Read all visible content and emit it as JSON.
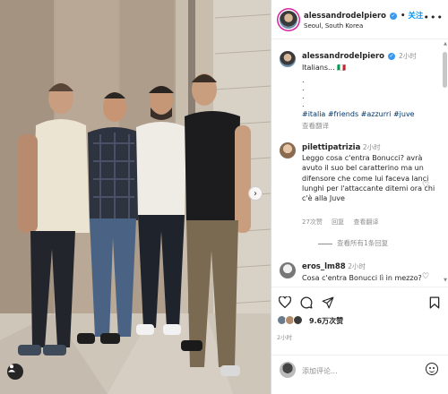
{
  "header": {
    "username": "alessandrodelpiero",
    "verified_mark": "✓",
    "separator": "•",
    "follow_label": "关注",
    "location": "Seoul, South Korea",
    "more_icon": "more-icon"
  },
  "caption": {
    "username": "alessandrodelpiero",
    "time": "2小时",
    "text": "Italians... 🇮🇹",
    "dots": ".\n.\n.\n.",
    "hashtags": "#italia #friends #azzurri #juve",
    "translate_label": "查看翻译"
  },
  "comments": [
    {
      "username": "pilettipatrizia",
      "time": "2小时",
      "text": "Leggo cosa c'entra Bonucci? avrà avuto il suo bel caratterino ma un difensore che come lui faceva lanci lunghi per l'attaccante ditemi ora chi c'è alla Juve",
      "likes": "27次赞",
      "reply_label": "回复",
      "translate_label": "查看翻译",
      "view_replies_label": "查看所有1条回复"
    },
    {
      "username": "eros_lm88",
      "time": "2小时",
      "text": "Cosa c'entra Bonucci lì in mezzo?"
    }
  ],
  "likes_summary": "9.6万次赞",
  "post_time": "2小时",
  "add_comment_placeholder": "添加评论...",
  "colors": {
    "accent": "#0095f6",
    "hashtag": "#00376b",
    "secondary_text": "#8e8e8e",
    "verified": "#3897f0"
  }
}
